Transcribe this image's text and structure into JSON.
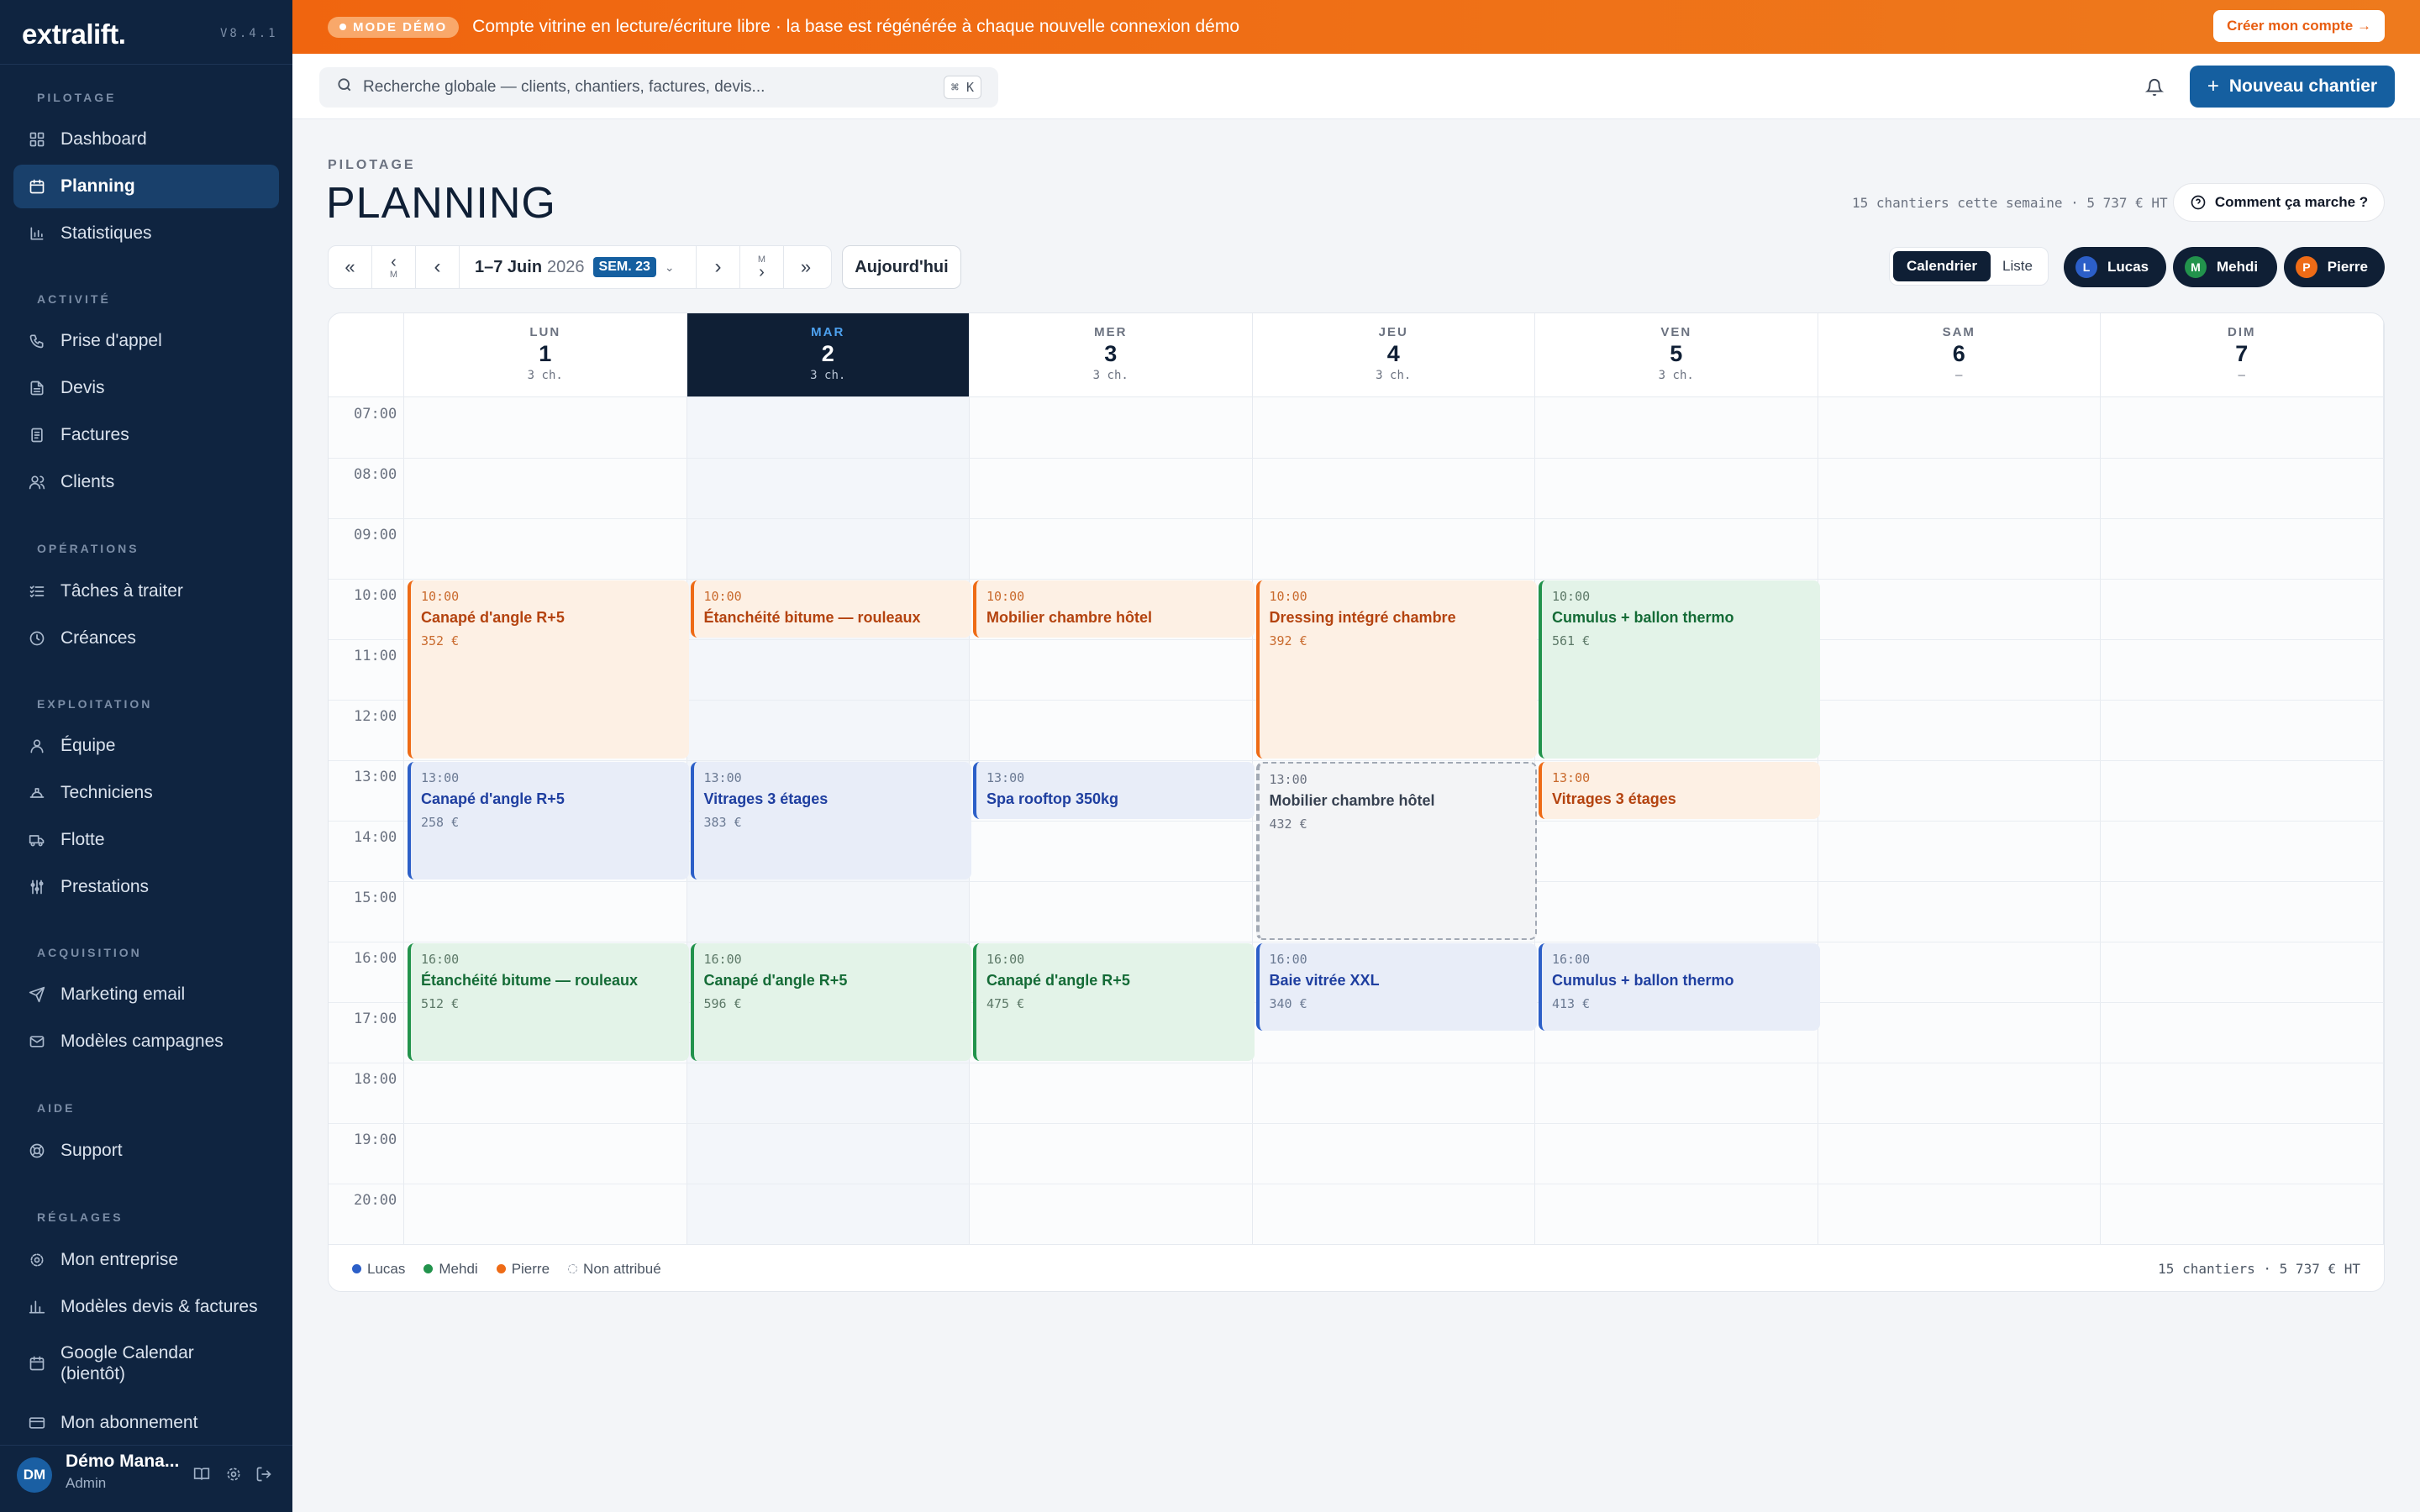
{
  "app": {
    "logo": "extralift.",
    "version": "V8.4.1"
  },
  "sidebar": {
    "sections": [
      {
        "title": "PILOTAGE",
        "items": [
          {
            "label": "Dashboard",
            "icon": "grid-icon"
          },
          {
            "label": "Planning",
            "icon": "calendar-icon",
            "active": true
          },
          {
            "label": "Statistiques",
            "icon": "bar-chart-icon"
          }
        ]
      },
      {
        "title": "ACTIVITÉ",
        "items": [
          {
            "label": "Prise d'appel",
            "icon": "phone-icon"
          },
          {
            "label": "Devis",
            "icon": "document-icon"
          },
          {
            "label": "Factures",
            "icon": "invoice-icon"
          },
          {
            "label": "Clients",
            "icon": "users-icon"
          }
        ]
      },
      {
        "title": "OPÉRATIONS",
        "items": [
          {
            "label": "Tâches à traiter",
            "icon": "task-list-icon"
          },
          {
            "label": "Créances",
            "icon": "clock-icon"
          }
        ]
      },
      {
        "title": "EXPLOITATION",
        "items": [
          {
            "label": "Équipe",
            "icon": "team-icon"
          },
          {
            "label": "Techniciens",
            "icon": "helmet-icon"
          },
          {
            "label": "Flotte",
            "icon": "truck-icon"
          },
          {
            "label": "Prestations",
            "icon": "sliders-icon"
          }
        ]
      },
      {
        "title": "ACQUISITION",
        "items": [
          {
            "label": "Marketing email",
            "icon": "send-icon"
          },
          {
            "label": "Modèles campagnes",
            "icon": "mail-icon"
          }
        ]
      },
      {
        "title": "AIDE",
        "items": [
          {
            "label": "Support",
            "icon": "lifebuoy-icon"
          }
        ]
      },
      {
        "title": "RÉGLAGES",
        "items": [
          {
            "label": "Mon entreprise",
            "icon": "gear-icon"
          },
          {
            "label": "Modèles devis & factures",
            "icon": "template-icon"
          },
          {
            "label": "Google Calendar (bientôt)",
            "icon": "calendar-icon"
          },
          {
            "label": "Mon abonnement",
            "icon": "card-icon"
          }
        ]
      }
    ],
    "user": {
      "initials": "DM",
      "name": "Démo Mana...",
      "role": "Admin"
    }
  },
  "banner": {
    "badge": "MODE DÉMO",
    "text": "Compte vitrine en lecture/écriture libre · la base est régénérée à chaque nouvelle connexion démo",
    "cta": "Créer mon compte →"
  },
  "topbar": {
    "search_placeholder": "Recherche globale — clients, chantiers, factures, devis...",
    "shortcut": "⌘ K",
    "new_button": "Nouveau chantier"
  },
  "page": {
    "eyebrow": "PILOTAGE",
    "title": "PLANNING",
    "summary": "15 chantiers cette semaine · 5 737 € HT",
    "help_button": "Comment ça marche ?"
  },
  "nav": {
    "range": "1–7 Juin",
    "year": "2026",
    "week": "SEM. 23",
    "month_label": "M",
    "today": "Aujourd'hui"
  },
  "views": {
    "calendar": "Calendrier",
    "list": "Liste"
  },
  "technicians": [
    {
      "initial": "L",
      "name": "Lucas",
      "color": "#2c5fc8"
    },
    {
      "initial": "M",
      "name": "Mehdi",
      "color": "#22934c"
    },
    {
      "initial": "P",
      "name": "Pierre",
      "color": "#ee6b16"
    }
  ],
  "calendar": {
    "days": [
      {
        "name": "LUN",
        "date": "1",
        "count": "3 ch."
      },
      {
        "name": "MAR",
        "date": "2",
        "count": "3 ch.",
        "today": true
      },
      {
        "name": "MER",
        "date": "3",
        "count": "3 ch."
      },
      {
        "name": "JEU",
        "date": "4",
        "count": "3 ch."
      },
      {
        "name": "VEN",
        "date": "5",
        "count": "3 ch."
      },
      {
        "name": "SAM",
        "date": "6",
        "count": "—"
      },
      {
        "name": "DIM",
        "date": "7",
        "count": "—"
      }
    ],
    "hours": [
      "07:00",
      "08:00",
      "09:00",
      "10:00",
      "11:00",
      "12:00",
      "13:00",
      "14:00",
      "15:00",
      "16:00",
      "17:00",
      "18:00",
      "19:00",
      "20:00"
    ],
    "events": [
      {
        "day": 0,
        "start": "10:00",
        "hours": 3,
        "title": "Canapé d'angle R+5",
        "price": "352 €",
        "tech": "Pierre"
      },
      {
        "day": 0,
        "start": "13:00",
        "hours": 2,
        "title": "Canapé d'angle R+5",
        "price": "258 €",
        "tech": "Lucas"
      },
      {
        "day": 0,
        "start": "16:00",
        "hours": 2,
        "title": "Étanchéité bitume — rouleaux",
        "price": "512 €",
        "tech": "Mehdi"
      },
      {
        "day": 1,
        "start": "10:00",
        "hours": 1,
        "title": "Étanchéité bitume — rouleaux",
        "price": "",
        "tech": "Pierre"
      },
      {
        "day": 1,
        "start": "13:00",
        "hours": 2,
        "title": "Vitrages 3 étages",
        "price": "383 €",
        "tech": "Lucas"
      },
      {
        "day": 1,
        "start": "16:00",
        "hours": 2,
        "title": "Canapé d'angle R+5",
        "price": "596 €",
        "tech": "Mehdi"
      },
      {
        "day": 2,
        "start": "10:00",
        "hours": 1,
        "title": "Mobilier chambre hôtel",
        "price": "",
        "tech": "Pierre"
      },
      {
        "day": 2,
        "start": "13:00",
        "hours": 1,
        "title": "Spa rooftop 350kg",
        "price": "",
        "tech": "Lucas"
      },
      {
        "day": 2,
        "start": "16:00",
        "hours": 2,
        "title": "Canapé d'angle R+5",
        "price": "475 €",
        "tech": "Mehdi"
      },
      {
        "day": 3,
        "start": "10:00",
        "hours": 3,
        "title": "Dressing intégré chambre",
        "price": "392 €",
        "tech": "Pierre"
      },
      {
        "day": 3,
        "start": "13:00",
        "hours": 3,
        "title": "Mobilier chambre hôtel",
        "price": "432 €",
        "tech": "Non attribué"
      },
      {
        "day": 3,
        "start": "16:00",
        "hours": 1.5,
        "title": "Baie vitrée XXL",
        "price": "340 €",
        "tech": "Lucas"
      },
      {
        "day": 4,
        "start": "10:00",
        "hours": 3,
        "title": "Cumulus + ballon thermo",
        "price": "561 €",
        "tech": "Mehdi"
      },
      {
        "day": 4,
        "start": "13:00",
        "hours": 1,
        "title": "Vitrages 3 étages",
        "price": "",
        "tech": "Pierre"
      },
      {
        "day": 4,
        "start": "16:00",
        "hours": 1.5,
        "title": "Cumulus + ballon thermo",
        "price": "413 €",
        "tech": "Lucas"
      }
    ]
  },
  "legend": {
    "items": [
      {
        "label": "Lucas",
        "color": "#2c5fc8"
      },
      {
        "label": "Mehdi",
        "color": "#22934c"
      },
      {
        "label": "Pierre",
        "color": "#ee6b16"
      },
      {
        "label": "Non attribué",
        "color": "dashed"
      }
    ],
    "total": "15 chantiers · 5 737 € HT"
  }
}
